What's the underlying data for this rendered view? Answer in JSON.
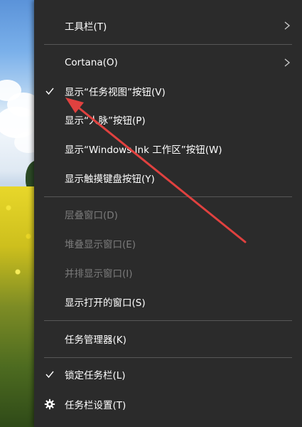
{
  "colors": {
    "menu_background": "#2b2b2b",
    "text": "#ffffff",
    "disabled_text": "#7c7c7c",
    "separator": "#575757",
    "annotation_arrow": "#e0413f"
  },
  "context_menu": {
    "toolbars": {
      "label": "工具栏(T)",
      "icon": "chevron-right-icon"
    },
    "cortana": {
      "label": "Cortana(O)",
      "icon": "chevron-right-icon"
    },
    "show_task_view": {
      "label": "显示“任务视图”按钮(V)",
      "checked": true
    },
    "show_people": {
      "label": "显示“人脉”按钮(P)"
    },
    "show_ink_workspace": {
      "label": "显示“Windows Ink 工作区”按钮(W)"
    },
    "show_touch_keyboard": {
      "label": "显示触摸键盘按钮(Y)"
    },
    "cascade_windows": {
      "label": "层叠窗口(D)",
      "disabled": true
    },
    "stack_windows": {
      "label": "堆叠显示窗口(E)",
      "disabled": true
    },
    "side_by_side": {
      "label": "并排显示窗口(I)",
      "disabled": true
    },
    "show_open_windows": {
      "label": "显示打开的窗口(S)"
    },
    "task_manager": {
      "label": "任务管理器(K)"
    },
    "lock_taskbar": {
      "label": "锁定任务栏(L)",
      "checked": true
    },
    "taskbar_settings": {
      "label": "任务栏设置(T)",
      "icon": "gear-icon"
    }
  }
}
